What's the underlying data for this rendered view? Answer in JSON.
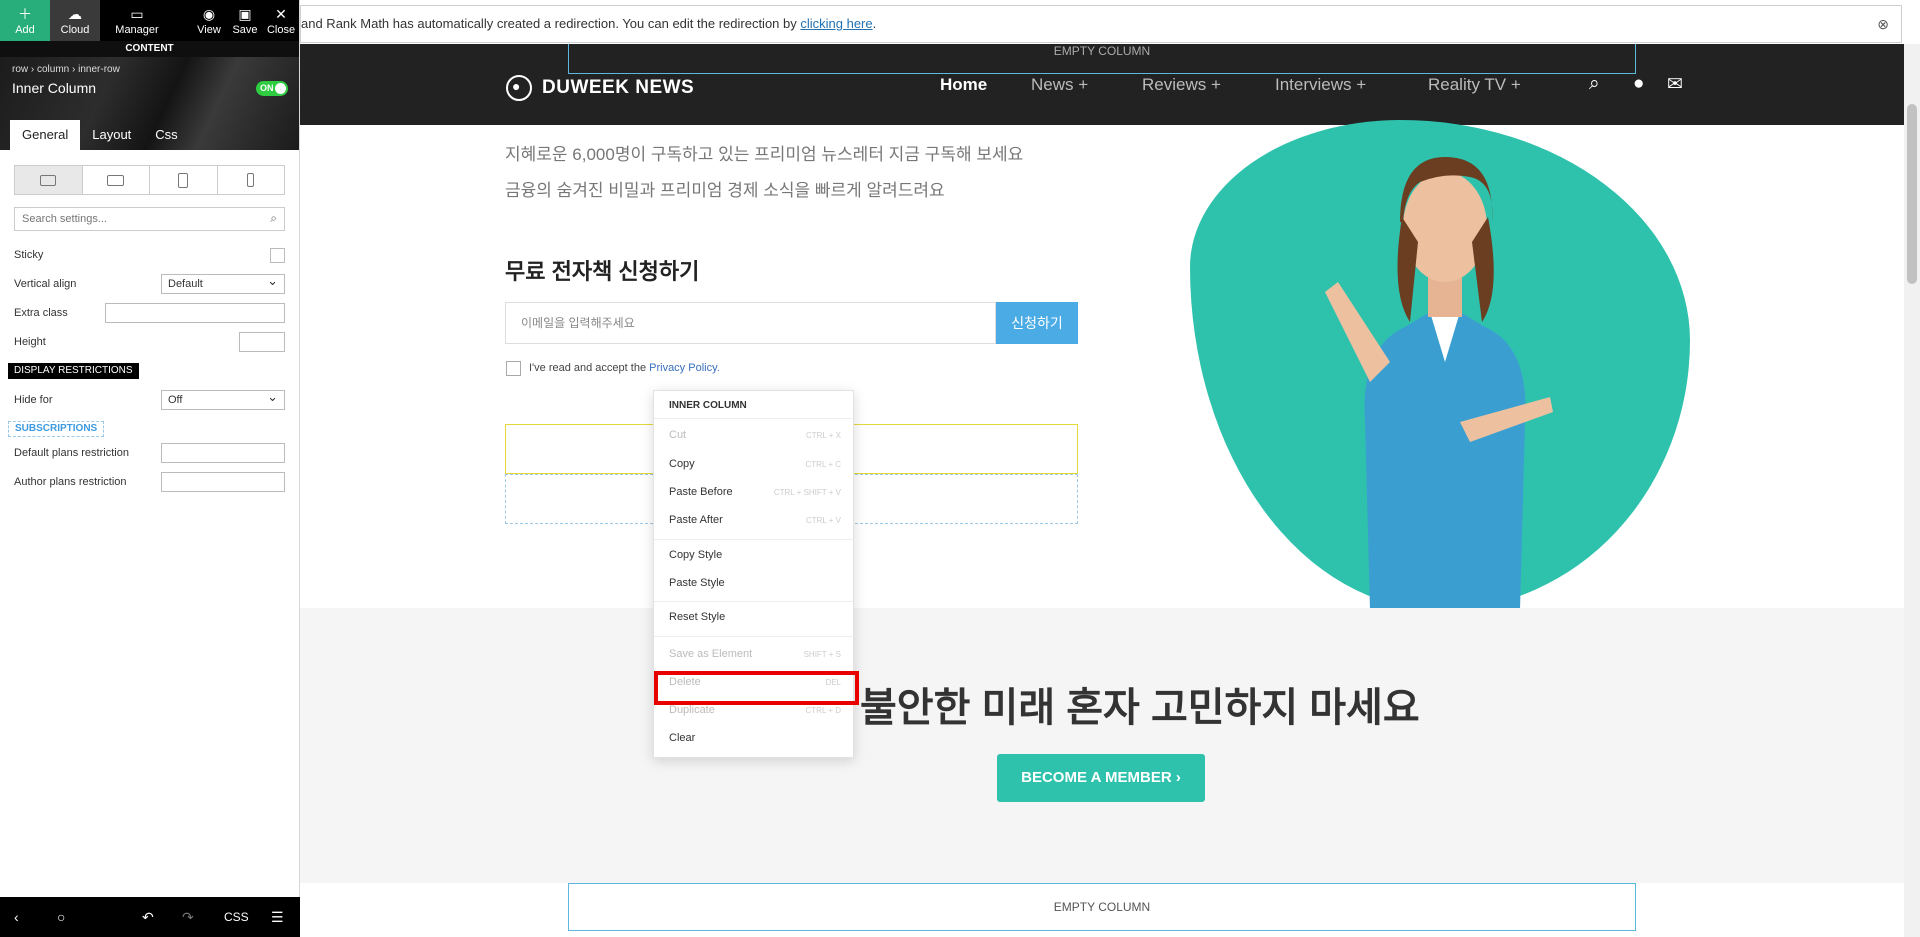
{
  "editor": {
    "toolbar": {
      "add": "Add",
      "cloud": "Cloud",
      "manager": "Manager",
      "view": "View",
      "save": "Save",
      "close": "Close"
    },
    "content_label": "CONTENT",
    "breadcrumb": "row  ›  column  ›  inner-row",
    "element_title": "Inner Column",
    "toggle": "ON",
    "tabs": [
      "General",
      "Layout",
      "Css"
    ],
    "search_placeholder": "Search settings...",
    "fields": {
      "sticky": "Sticky",
      "vertical_align": "Vertical align",
      "vertical_align_value": "Default",
      "extra_class": "Extra class",
      "height": "Height",
      "display_restrictions": "DISPLAY RESTRICTIONS",
      "hide_for": "Hide for",
      "hide_for_value": "Off",
      "subscriptions": "SUBSCRIPTIONS",
      "default_plans": "Default plans restriction",
      "author_plans": "Author plans restriction"
    },
    "bottom": {
      "css": "CSS"
    }
  },
  "notice": {
    "text": "and Rank Math has automatically created a redirection. You can edit the redirection by ",
    "link": "clicking here",
    "tail": "."
  },
  "site": {
    "empty_column": "EMPTY COLUMN",
    "logo": "DUWEEK NEWS",
    "nav": [
      "Home",
      "News  +",
      "Reviews  +",
      "Interviews  +",
      "Reality TV  +"
    ],
    "hero_line1": "지혜로운 6,000명이 구독하고 있는 프리미엄 뉴스레터 지금 구독해 보세요",
    "hero_line2": "금융의 숨겨진 비밀과 프리미엄 경제 소식을 빠르게 알려드려요",
    "form_title": "무료 전자책 신청하기",
    "email_placeholder": "이메일을 입력해주세요",
    "subscribe_btn": "신청하기",
    "policy_text": "I've read and accept the ",
    "policy_link": "Privacy Policy.",
    "big_title": "불안한 미래 혼자 고민하지 마세요",
    "member_btn": "BECOME A MEMBER  ›"
  },
  "context_menu": {
    "title": "INNER COLUMN",
    "items": [
      {
        "name": "Cut",
        "shortcut": "CTRL + X",
        "disabled": true
      },
      {
        "name": "Copy",
        "shortcut": "CTRL + C",
        "disabled": false
      },
      {
        "name": "Paste Before",
        "shortcut": "CTRL + SHIFT + V",
        "disabled": false
      },
      {
        "name": "Paste After",
        "shortcut": "CTRL + V",
        "disabled": false
      },
      {
        "name": "Copy Style",
        "shortcut": "",
        "disabled": false
      },
      {
        "name": "Paste Style",
        "shortcut": "",
        "disabled": false
      },
      {
        "name": "Reset Style",
        "shortcut": "",
        "disabled": false
      },
      {
        "name": "Save as Element",
        "shortcut": "SHIFT + S",
        "disabled": true
      },
      {
        "name": "Delete",
        "shortcut": "DEL",
        "disabled": true
      },
      {
        "name": "Duplicate",
        "shortcut": "CTRL + D",
        "disabled": true
      },
      {
        "name": "Clear",
        "shortcut": "",
        "disabled": false
      }
    ]
  },
  "colors": {
    "accent": "#2ec2ad",
    "highlight": "#e80000",
    "add_button": "#27ae7a",
    "subscribe": "#4aabe5"
  }
}
